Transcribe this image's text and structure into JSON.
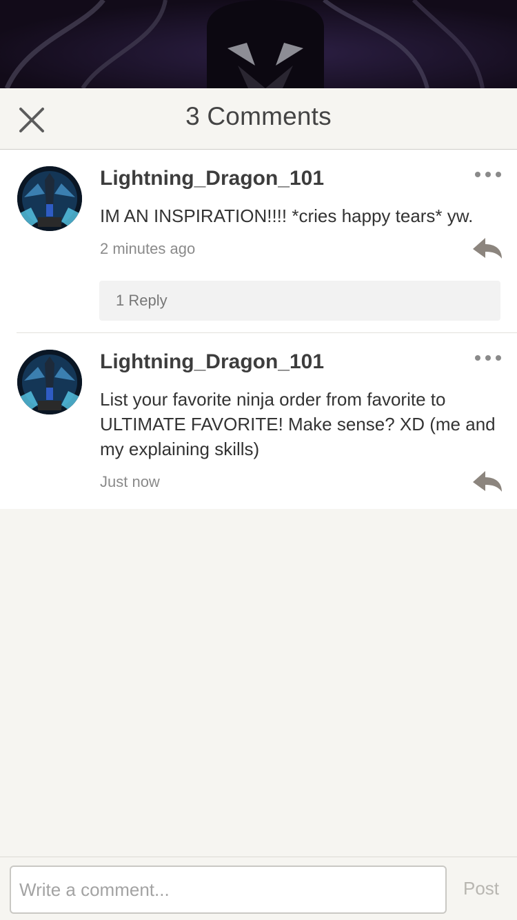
{
  "header": {
    "title": "3 Comments",
    "close_icon": "close-icon"
  },
  "comments": [
    {
      "username": "Lightning_Dragon_101",
      "text": "IM AN INSPIRATION!!!!  *cries happy tears* yw.",
      "time": "2 minutes ago",
      "replies_label": "1 Reply"
    },
    {
      "username": "Lightning_Dragon_101",
      "text": "List your favorite ninja order from favorite to ULTIMATE FAVORITE! Make sense? XD (me and my explaining skills)",
      "time": "Just now"
    }
  ],
  "composer": {
    "placeholder": "Write a comment...",
    "post_label": "Post"
  },
  "colors": {
    "background": "#f6f5f1",
    "card": "#ffffff",
    "muted_text": "#8a8a8a",
    "post_disabled": "#b8b6b1"
  }
}
